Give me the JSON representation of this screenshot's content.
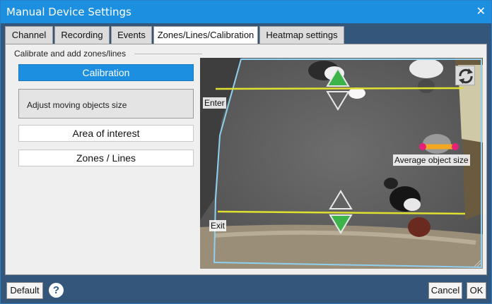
{
  "window": {
    "title": "Manual Device Settings",
    "close_glyph": "✕"
  },
  "tabs": [
    {
      "label": "Channel",
      "active": false
    },
    {
      "label": "Recording",
      "active": false
    },
    {
      "label": "Events",
      "active": false
    },
    {
      "label": "Zones/Lines/Calibration",
      "active": true
    },
    {
      "label": "Heatmap settings",
      "active": false
    }
  ],
  "panel": {
    "group_label": "Calibrate and add zones/lines",
    "calibration_label": "Calibration",
    "description": "Adjust moving objects size",
    "area_label": "Area of interest",
    "zones_label": "Zones / Lines"
  },
  "video": {
    "enter_label": "Enter",
    "exit_label": "Exit",
    "avg_size_label": "Average object size",
    "line_color": "#e0e030",
    "arrow_color": "#3cb44a",
    "size_bar_color": "#f5a623",
    "size_dot_color": "#e8207a",
    "zone_color": "#8fd0f0",
    "rotate_icon": "rotate-icon"
  },
  "footer": {
    "default_label": "Default",
    "help_glyph": "?",
    "cancel_label": "Cancel",
    "ok_label": "OK"
  }
}
